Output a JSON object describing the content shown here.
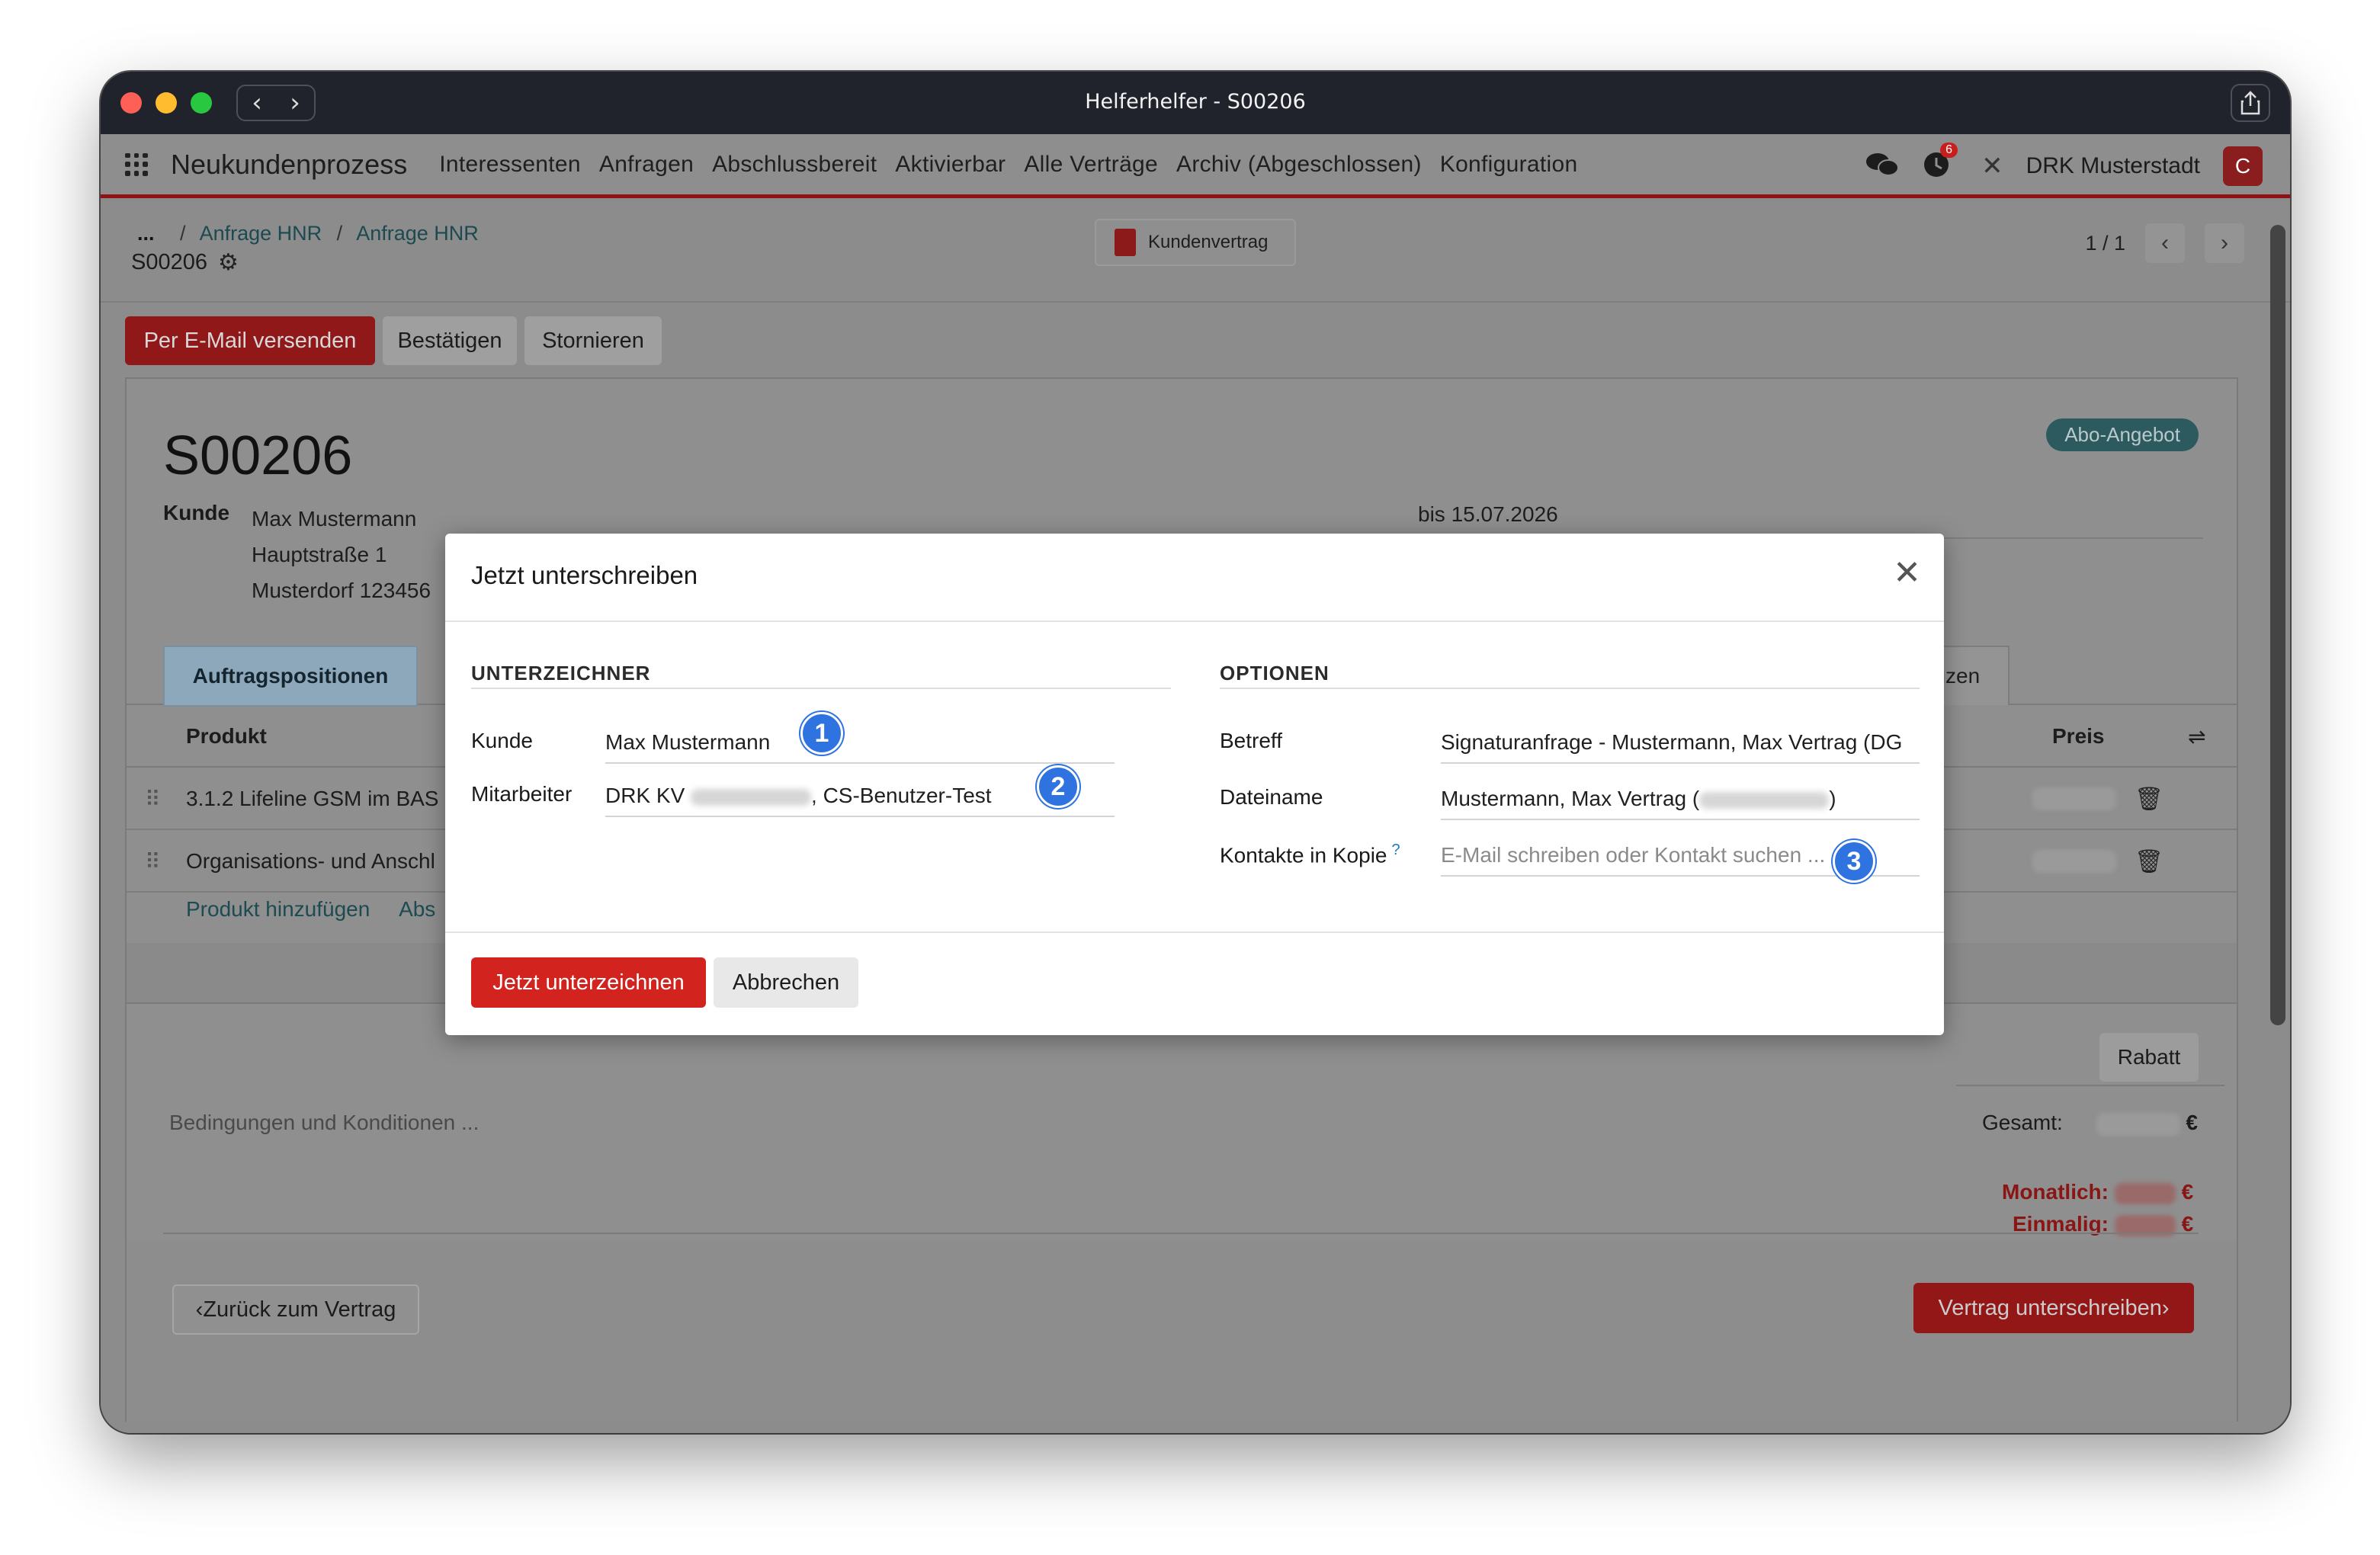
{
  "window": {
    "title": "Helferhelfer - S00206"
  },
  "navbar": {
    "brand": "Neukundenprozess",
    "menu": [
      "Interessenten",
      "Anfragen",
      "Abschlussbereit",
      "Aktivierbar",
      "Alle Verträge",
      "Archiv (Abgeschlossen)",
      "Konfiguration"
    ],
    "activity_count": "6",
    "company": "DRK Musterstadt",
    "avatar_letter": "C"
  },
  "breadcrumb": {
    "ellipsis": "...",
    "items": [
      "Anfrage HNR",
      "Anfrage HNR"
    ],
    "sep": "/"
  },
  "record": {
    "id": "S00206"
  },
  "toolbar": {
    "pdf_label": "Kundenvertrag",
    "pager": "1 / 1"
  },
  "actions": {
    "email": "Per E-Mail versenden",
    "confirm": "Bestätigen",
    "cancel": "Stornieren"
  },
  "form": {
    "title": "S00206",
    "badge": "Abo-Angebot",
    "customer_label": "Kunde",
    "address": [
      "Max Mustermann",
      "Hauptstraße 1",
      "Musterdorf 123456"
    ],
    "until": "bis 15.07.2026",
    "tab_active": "Auftragspositionen",
    "tab_right": "tizen",
    "col_product": "Produkt",
    "col_price": "Preis",
    "rows": [
      "3.1.2 Lifeline GSM im BAS",
      "Organisations- und Anschl"
    ],
    "add_product": "Produkt hinzufügen",
    "add_section": "Abs",
    "rabatt": "Rabatt",
    "conditions": "Bedingungen und Konditionen ...",
    "total_label": "Gesamt:",
    "currency": "€",
    "monthly_label": "Monatlich:",
    "once_label": "Einmalig:",
    "back": "Zurück zum Vertrag",
    "sign": "Vertrag unterschreiben"
  },
  "modal": {
    "title": "Jetzt unterschreiben",
    "signers_section": "UNTERZEICHNER",
    "options_section": "OPTIONEN",
    "customer_label": "Kunde",
    "customer_value": "Max Mustermann",
    "employee_label": "Mitarbeiter",
    "employee_prefix": "DRK KV",
    "employee_suffix": ", CS-Benutzer-Test",
    "subject_label": "Betreff",
    "subject_value": "Signaturanfrage - Mustermann, Max Vertrag (DG",
    "filename_label": "Dateiname",
    "filename_prefix": "Mustermann, Max Vertrag (",
    "filename_suffix": ")",
    "cc_label": "Kontakte in Kopie",
    "cc_help": "?",
    "cc_placeholder": "E-Mail schreiben oder Kontakt suchen ...",
    "sign_now": "Jetzt unterzeichnen",
    "abort": "Abbrechen",
    "markers": [
      "1",
      "2",
      "3"
    ]
  },
  "icons": {
    "close": "close-icon",
    "grid": "apps-grid-icon",
    "pdf": "pdf-icon",
    "gear": "gear-icon",
    "chat": "chat-icon",
    "clock": "activity-clock-icon",
    "tools": "tools-icon",
    "trash": "trash-icon",
    "share": "share-icon"
  }
}
